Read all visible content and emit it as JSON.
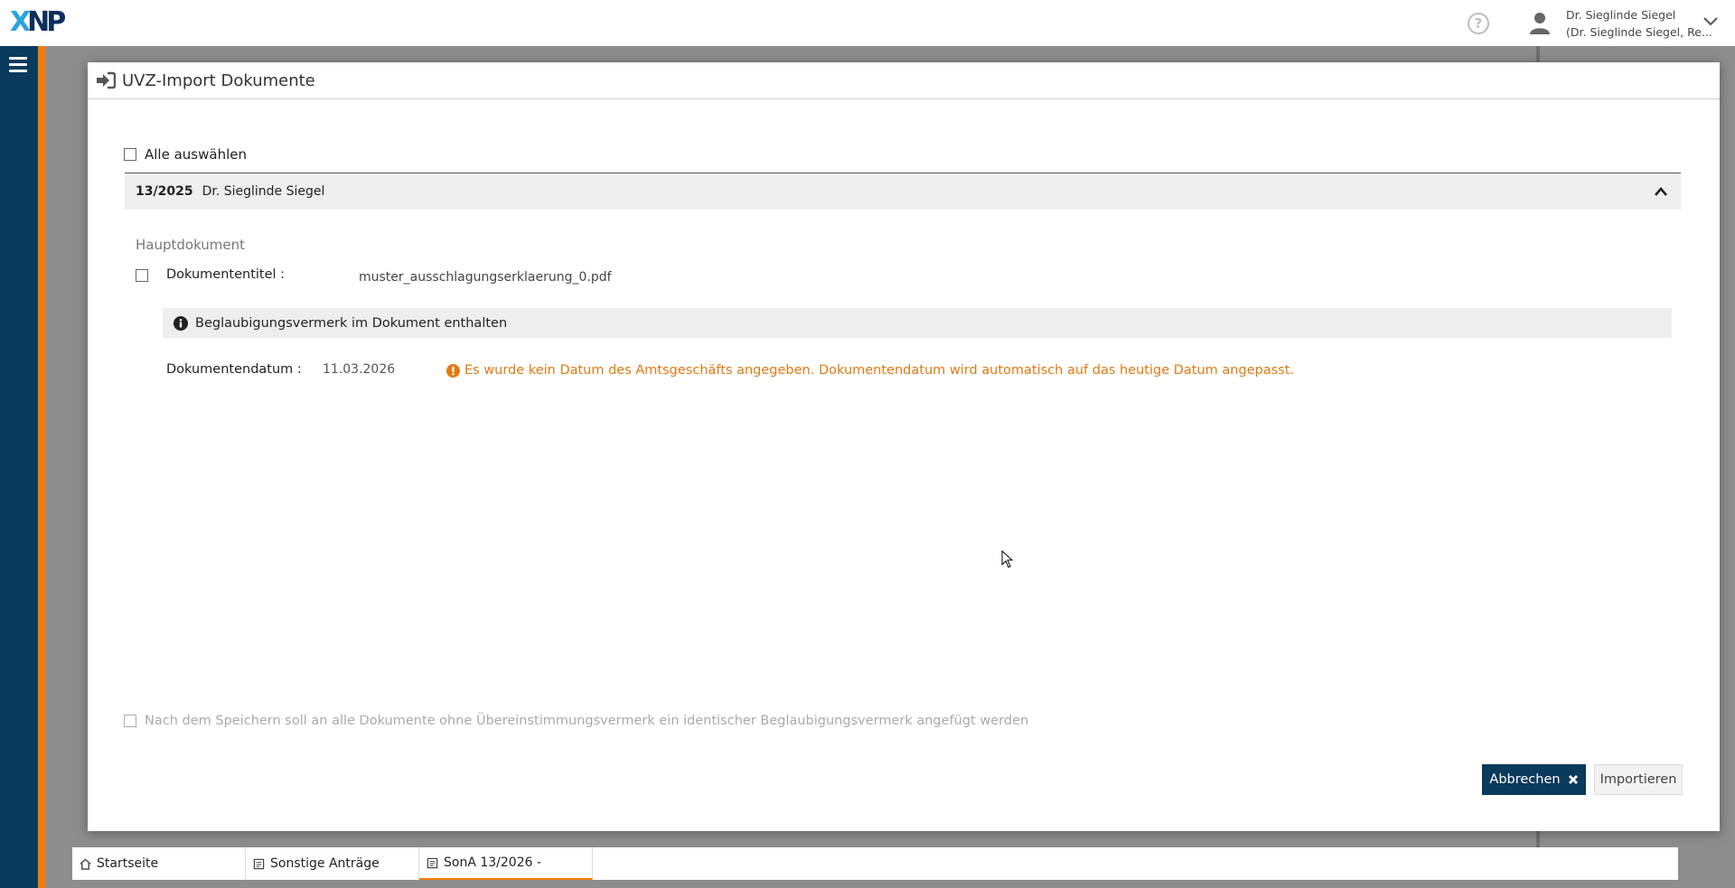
{
  "topbar": {
    "logo_part1": "X",
    "logo_part2": "NP",
    "user_line1": "Dr. Sieglinde Siegel",
    "user_line2": "(Dr. Sieglinde Siegel, Re..."
  },
  "modal": {
    "title": "UVZ-Import Dokumente",
    "select_all_label": "Alle auswählen",
    "group": {
      "number": "13/2025",
      "name": "Dr. Sieglinde Siegel"
    },
    "section_label": "Hauptdokument",
    "document_title_label": "Dokumententitel :",
    "document_title_value": "muster_ausschlagungserklaerung_0.pdf",
    "info_text": "Beglaubigungsvermerk im Dokument enthalten",
    "document_date_label": "Dokumentendatum :",
    "document_date_value": "11.03.2026",
    "warning_text": "Es wurde kein Datum des Amtsgeschäfts angegeben. Dokumentendatum wird automatisch auf das heutige Datum angepasst.",
    "footer_check_label": "Nach dem Speichern soll an alle Dokumente ohne Übereinstimmungsvermerk ein identischer Beglaubigungsvermerk angefügt werden",
    "cancel_label": "Abbrechen",
    "import_label": "Importieren"
  },
  "tabs": [
    {
      "label": "Startseite",
      "icon": "home-icon"
    },
    {
      "label": "Sonstige Anträge",
      "icon": "document-icon"
    },
    {
      "label": "SonA 13/2026 -",
      "icon": "document-icon"
    }
  ],
  "colors": {
    "brand_navy": "#0a3a5c",
    "accent_orange": "#f07d0a",
    "warning_orange": "#e27a12"
  }
}
